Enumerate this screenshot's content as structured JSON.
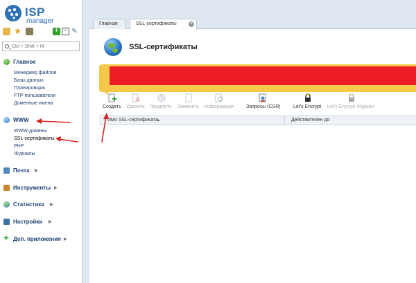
{
  "app": {
    "logo_top": "ISP",
    "logo_bottom": "manager"
  },
  "search": {
    "placeholder": "Ctrl + Shift + M",
    "value": ""
  },
  "sidebar": {
    "sections": [
      {
        "label": "Главное",
        "icon": "globe-icon",
        "items": [
          "Менеджер файлов",
          "Базы данных",
          "Планировщик",
          "FTP-пользователи",
          "Доменные имена"
        ]
      },
      {
        "label": "WWW",
        "icon": "www-globe-icon",
        "items": [
          "WWW-домены",
          "SSL-сертификаты",
          "PHP",
          "Журналы"
        ]
      },
      {
        "label": "Почта",
        "icon": "mail-icon",
        "items": []
      },
      {
        "label": "Инструменты",
        "icon": "tools-icon",
        "items": []
      },
      {
        "label": "Статистика",
        "icon": "stats-icon",
        "items": []
      },
      {
        "label": "Настройки",
        "icon": "settings-icon",
        "items": []
      },
      {
        "label": "Доп. приложения",
        "icon": "plus-icon",
        "items": []
      }
    ]
  },
  "tabs": [
    {
      "label": "Главная"
    },
    {
      "label": "SSL-сертификаты"
    }
  ],
  "page": {
    "title": "SSL-сертификаты"
  },
  "toolbar": {
    "actions": [
      {
        "label": "Создать",
        "icon": "create-icon",
        "enabled": true
      },
      {
        "label": "Удалить",
        "icon": "delete-icon",
        "enabled": false
      },
      {
        "label": "Продлить",
        "icon": "renew-icon",
        "enabled": false
      },
      {
        "label": "Заменить",
        "icon": "replace-icon",
        "enabled": false
      },
      {
        "label": "Информация",
        "icon": "info-icon",
        "enabled": false
      },
      {
        "label": "Запросы (CSR)",
        "icon": "csr-icon",
        "enabled": true
      },
      {
        "label": "Let's Encrypt",
        "icon": "lock-icon",
        "enabled": true
      },
      {
        "label": "Let's Encrypt Журнал",
        "icon": "lock-log-icon",
        "enabled": false
      }
    ]
  },
  "grid": {
    "columns": [
      "Имя SSL-сертификата",
      "Действителен до"
    ]
  },
  "colors": {
    "accent": "#2b6fb4",
    "banner": "#f6c84a",
    "redaction": "#ee1c25",
    "arrow": "#d42020"
  }
}
